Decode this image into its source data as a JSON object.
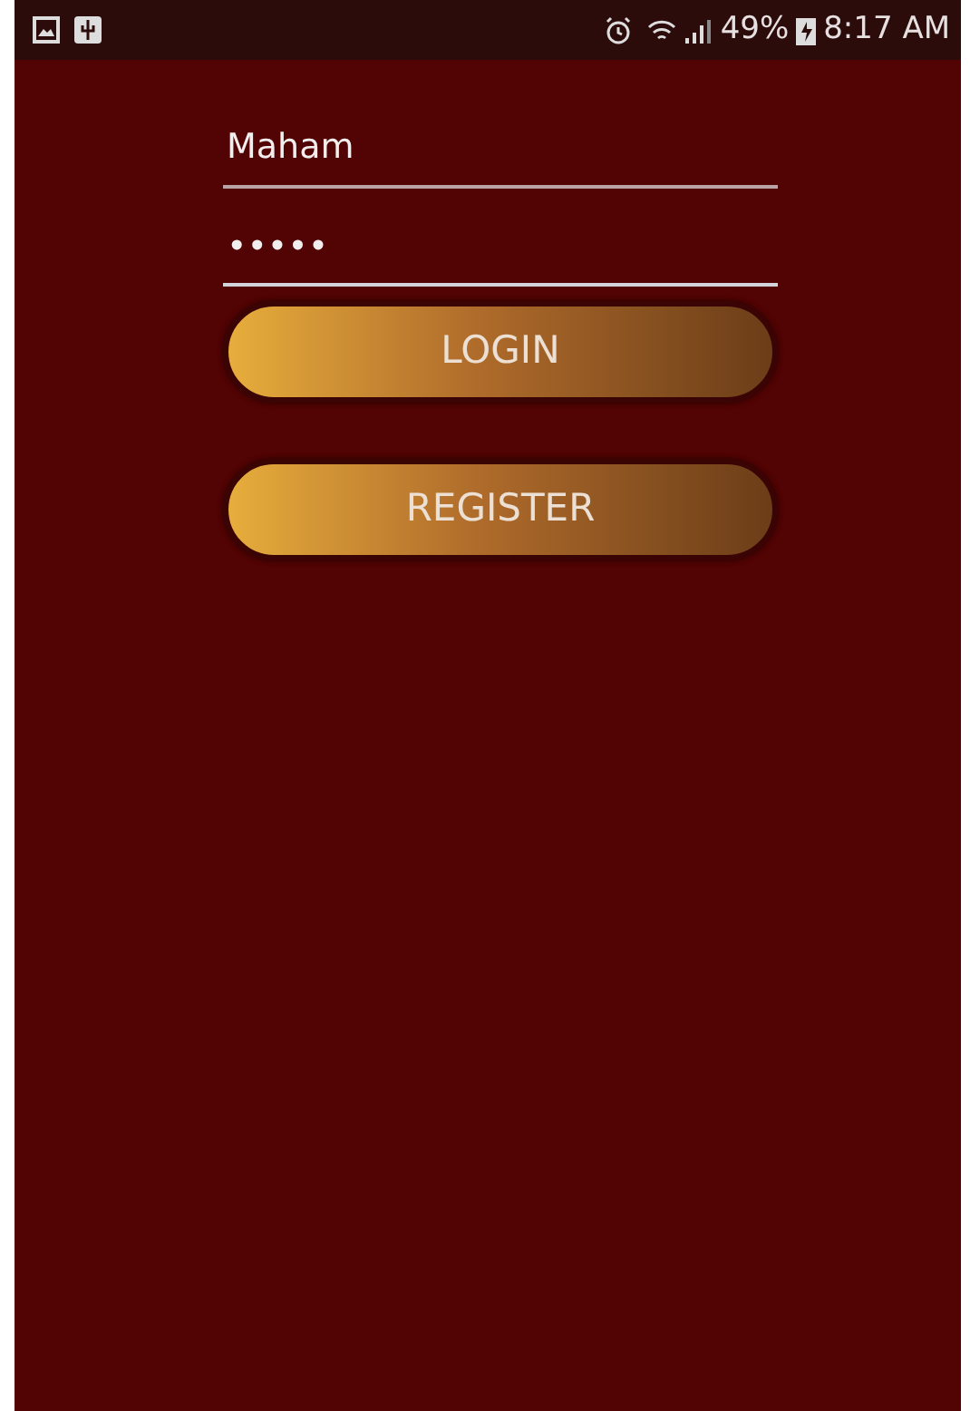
{
  "status_bar": {
    "battery": "49%",
    "time": "8:17 AM"
  },
  "username": {
    "value": "Maham"
  },
  "password": {
    "value": "•••••"
  },
  "buttons": [
    "LOGIN",
    "REGISTER"
  ]
}
